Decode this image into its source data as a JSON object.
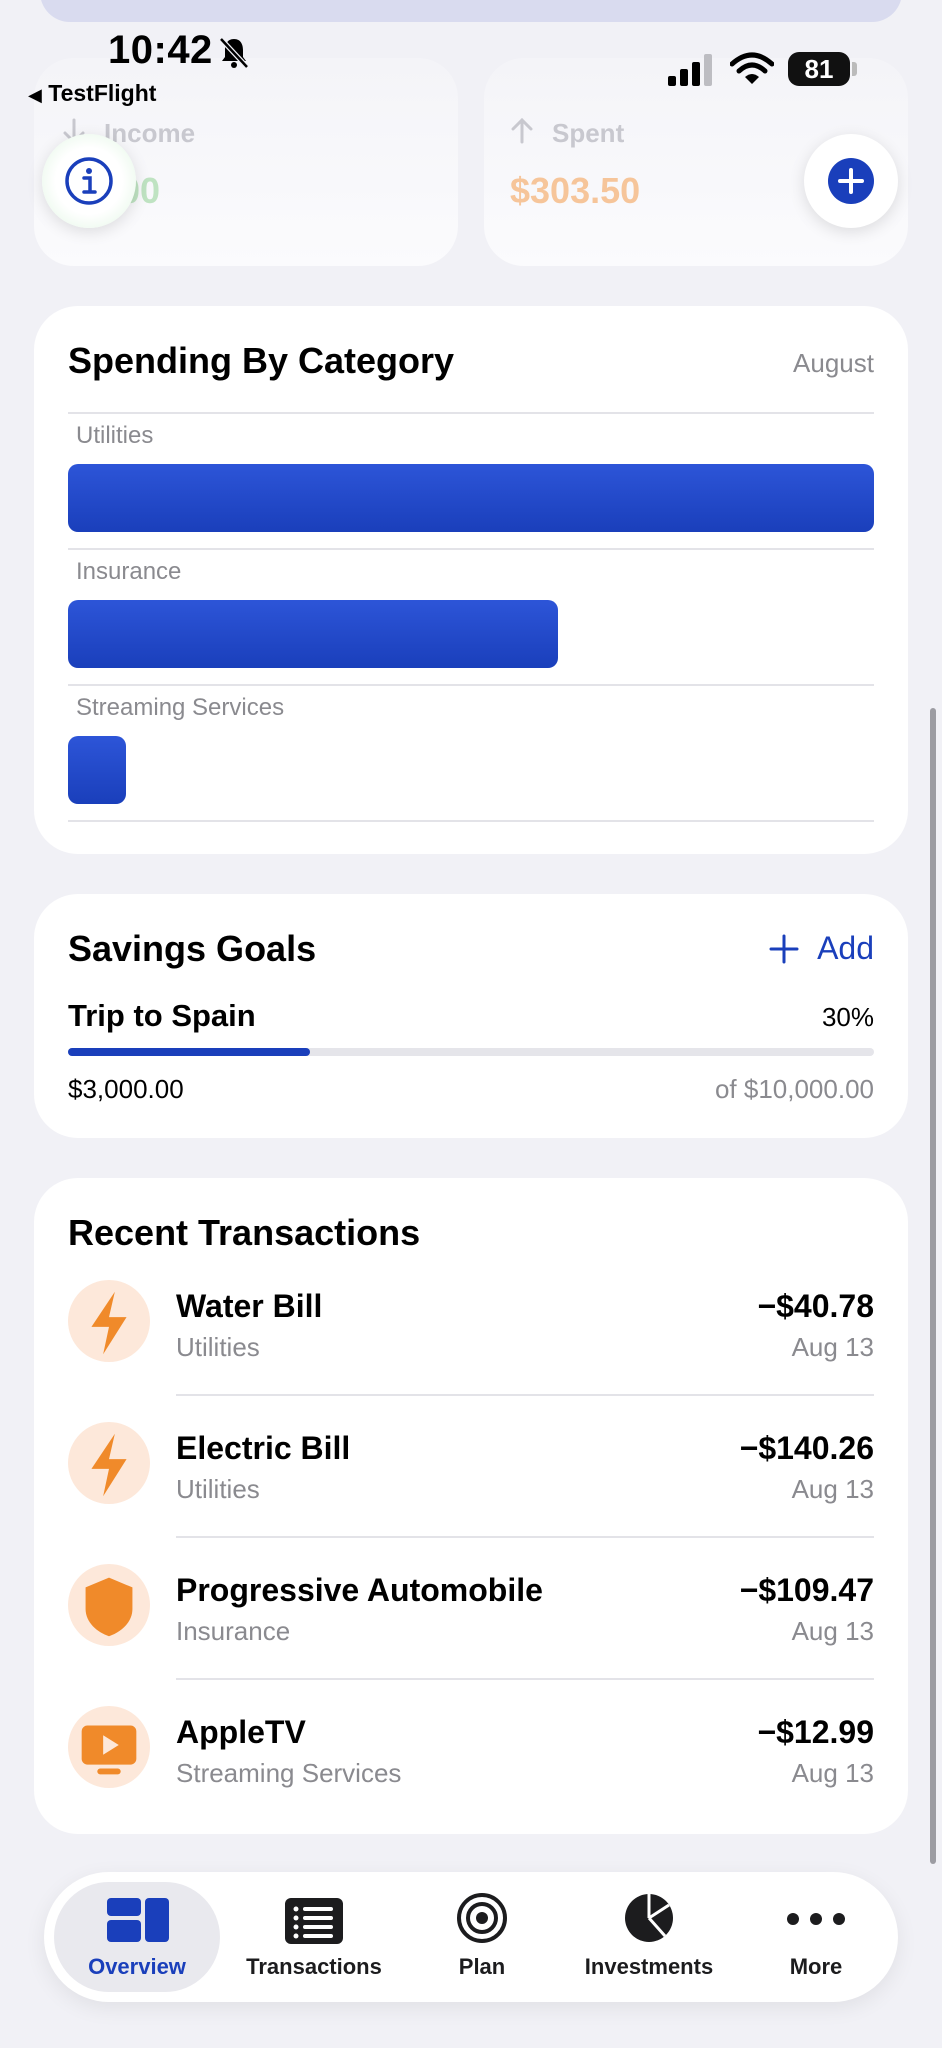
{
  "status_bar": {
    "time": "10:42",
    "back_app": "TestFlight",
    "battery": "81"
  },
  "stats": {
    "income": {
      "label": "Income",
      "value_partial": "00"
    },
    "spent": {
      "label": "Spent",
      "value": "$303.50"
    }
  },
  "spending": {
    "title": "Spending By Category",
    "month": "August",
    "chart_data": {
      "type": "bar",
      "categories": [
        "Utilities",
        "Insurance",
        "Streaming Services"
      ],
      "values": [
        180.04,
        109.47,
        12.99
      ]
    }
  },
  "savings": {
    "title": "Savings Goals",
    "add_label": "Add",
    "goal": {
      "name": "Trip to Spain",
      "percent_label": "30%",
      "progress": 0.3,
      "saved": "$3,000.00",
      "target": "of $10,000.00"
    }
  },
  "transactions": {
    "title": "Recent Transactions",
    "items": [
      {
        "name": "Water Bill",
        "category": "Utilities",
        "amount": "−$40.78",
        "date": "Aug 13",
        "icon": "bolt-icon"
      },
      {
        "name": "Electric Bill",
        "category": "Utilities",
        "amount": "−$140.26",
        "date": "Aug 13",
        "icon": "bolt-icon"
      },
      {
        "name": "Progressive Automobile",
        "category": "Insurance",
        "amount": "−$109.47",
        "date": "Aug 13",
        "icon": "shield-icon"
      },
      {
        "name": "AppleTV",
        "category": "Streaming Services",
        "amount": "−$12.99",
        "date": "Aug 13",
        "icon": "tv-play-icon"
      }
    ]
  },
  "tabs": [
    {
      "label": "Overview",
      "icon": "dashboard-icon",
      "active": true
    },
    {
      "label": "Transactions",
      "icon": "list-icon",
      "active": false
    },
    {
      "label": "Plan",
      "icon": "target-icon",
      "active": false
    },
    {
      "label": "Investments",
      "icon": "pie-chart-icon",
      "active": false
    },
    {
      "label": "More",
      "icon": "ellipsis-icon",
      "active": false
    }
  ],
  "colors": {
    "accent": "#1a3fbb",
    "icon_orange": "#f08a2a",
    "icon_bg": "#fde8da",
    "income_green": "#bfe3c2",
    "spent_orange": "#f6c59a"
  }
}
